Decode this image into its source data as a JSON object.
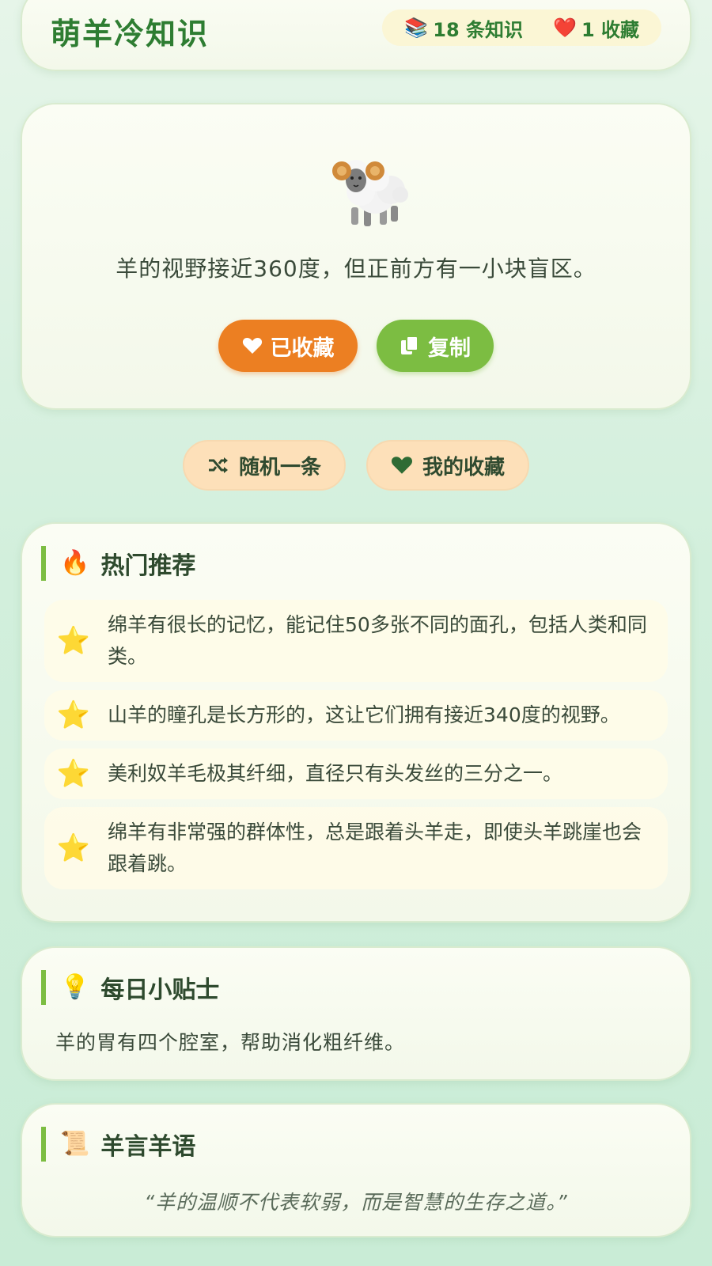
{
  "header": {
    "title": "萌羊冷知识",
    "stats": {
      "knowledge_icon": "books-icon",
      "knowledge_label": "18 条知识",
      "favorites_icon": "heart-icon",
      "favorites_label": "1 收藏"
    }
  },
  "main_card": {
    "icon": "sheep-icon",
    "fact": "羊的视野接近360度，但正前方有一小块盲区。",
    "favorite_button": "已收藏",
    "copy_button": "复制"
  },
  "actions": {
    "random_label": "随机一条",
    "my_favorites_label": "我的收藏"
  },
  "hot": {
    "title": "热门推荐",
    "icon": "fire-icon",
    "items": [
      "绵羊有很长的记忆，能记住50多张不同的面孔，包括人类和同类。",
      "山羊的瞳孔是长方形的，这让它们拥有接近340度的视野。",
      "美利奴羊毛极其纤细，直径只有头发丝的三分之一。",
      "绵羊有非常强的群体性，总是跟着头羊走，即使头羊跳崖也会跟着跳。"
    ]
  },
  "tip": {
    "title": "每日小贴士",
    "icon": "lightbulb-icon",
    "text": "羊的胃有四个腔室，帮助消化粗纤维。"
  },
  "quote": {
    "title": "羊言羊语",
    "icon": "scroll-icon",
    "text": "“羊的温顺不代表软弱，而是智慧的生存之道。”"
  },
  "colors": {
    "brand_green": "#2e7d32",
    "favorite_orange": "#ec7f22",
    "copy_green": "#7cbd42",
    "soft_button": "#fde0b9"
  }
}
